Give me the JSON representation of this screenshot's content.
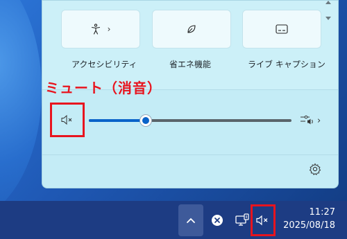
{
  "quick_settings": {
    "tiles": [
      {
        "label": "アクセシビリティ",
        "icon": "accessibility-icon",
        "has_chevron": true
      },
      {
        "label": "省エネ機能",
        "icon": "leaf-icon",
        "has_chevron": false
      },
      {
        "label": "ライブ キャプション",
        "icon": "captions-icon",
        "has_chevron": false
      }
    ],
    "annotation_label": "ミュート（消音）",
    "volume": {
      "level": 0.28,
      "muted": true
    },
    "settings_icon": "gear-icon",
    "audio_output_icon": "audio-output-icon",
    "chevron": "›"
  },
  "taskbar": {
    "time": "11:27",
    "date": "2025/08/18",
    "icons": [
      "chevron-up-icon",
      "close-circle-icon",
      "network-icon",
      "speaker-muted-icon"
    ]
  },
  "colors": {
    "accent": "#0a63c9",
    "annotation_red": "#e8141e",
    "taskbar": "#1d3c83"
  }
}
